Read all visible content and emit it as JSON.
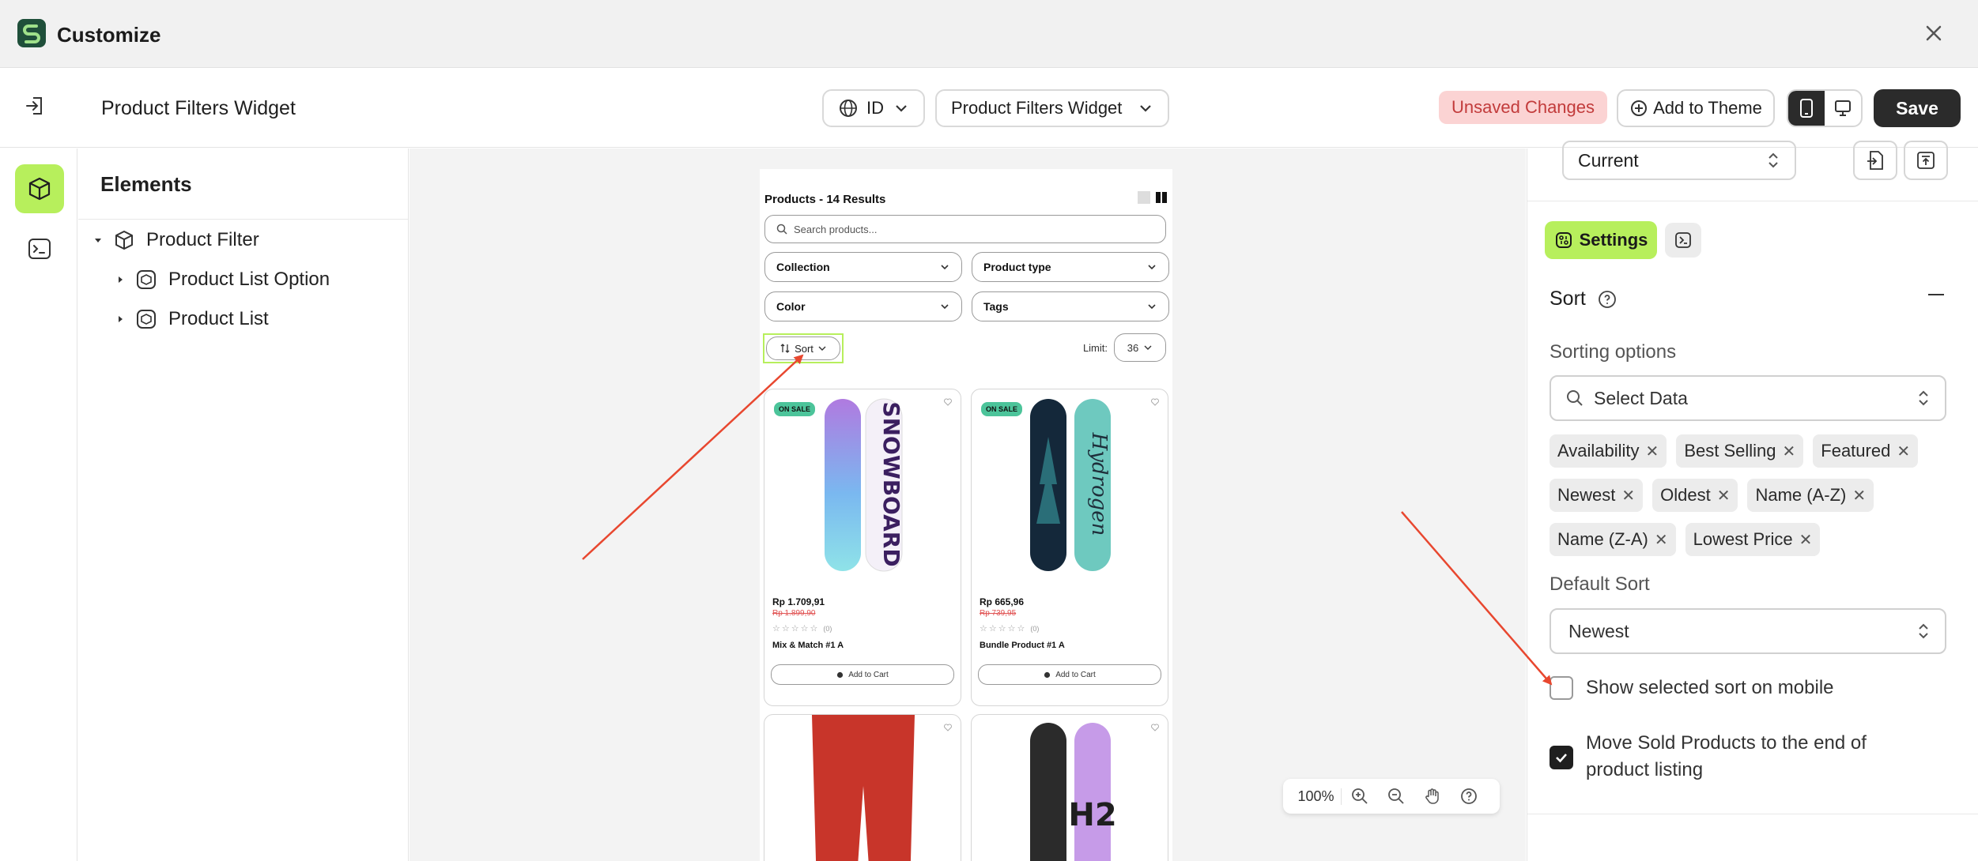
{
  "window": {
    "title": "Customize"
  },
  "header": {
    "page_title": "Product Filters Widget",
    "language": "ID",
    "widget_select": "Product Filters Widget",
    "unsaved_label": "Unsaved Changes",
    "add_to_theme_label": "Add to Theme",
    "save_label": "Save"
  },
  "elements_panel": {
    "title": "Elements",
    "tree": [
      {
        "label": "Product Filter"
      },
      {
        "label": "Product List Option"
      },
      {
        "label": "Product List"
      }
    ]
  },
  "preview": {
    "title": "Products - 14 Results",
    "search_placeholder": "Search products...",
    "filters": [
      "Collection",
      "Product type",
      "Color",
      "Tags"
    ],
    "sort_label": "Sort",
    "limit_label": "Limit:",
    "limit_value": "36",
    "products": [
      {
        "badge": "ON SALE",
        "price": "Rp 1.709,91",
        "old_price": "Rp 1.899,90",
        "stars": "☆☆☆☆☆",
        "review_count": "(0)",
        "name": "Mix & Match #1 A",
        "cart_label": "Add to Cart"
      },
      {
        "badge": "ON SALE",
        "price": "Rp 665,96",
        "old_price": "Rp 739,95",
        "stars": "☆☆☆☆☆",
        "review_count": "(0)",
        "name": "Bundle Product #1 A",
        "cart_label": "Add to Cart"
      }
    ],
    "zoom_level": "100%"
  },
  "right_panel": {
    "current_select": "Current",
    "settings_tab_label": "Settings",
    "section_title": "Sort",
    "sorting_options_label": "Sorting options",
    "select_placeholder": "Select Data",
    "chips": [
      "Availability",
      "Best Selling",
      "Featured",
      "Newest",
      "Oldest",
      "Name (A-Z)",
      "Name (Z-A)",
      "Lowest Price"
    ],
    "default_sort_label": "Default Sort",
    "default_sort_value": "Newest",
    "checkbox_mobile_label": "Show selected sort on mobile",
    "checkbox_mobile_checked": false,
    "checkbox_sold_label": "Move Sold Products to the end of product listing",
    "checkbox_sold_checked": true
  },
  "colors": {
    "accent": "#b7ef5c",
    "dark": "#2b2b2b",
    "unsaved_bg": "#fbd3d3",
    "unsaved_text": "#c23b3b",
    "annotation_arrow": "#e8472f"
  }
}
